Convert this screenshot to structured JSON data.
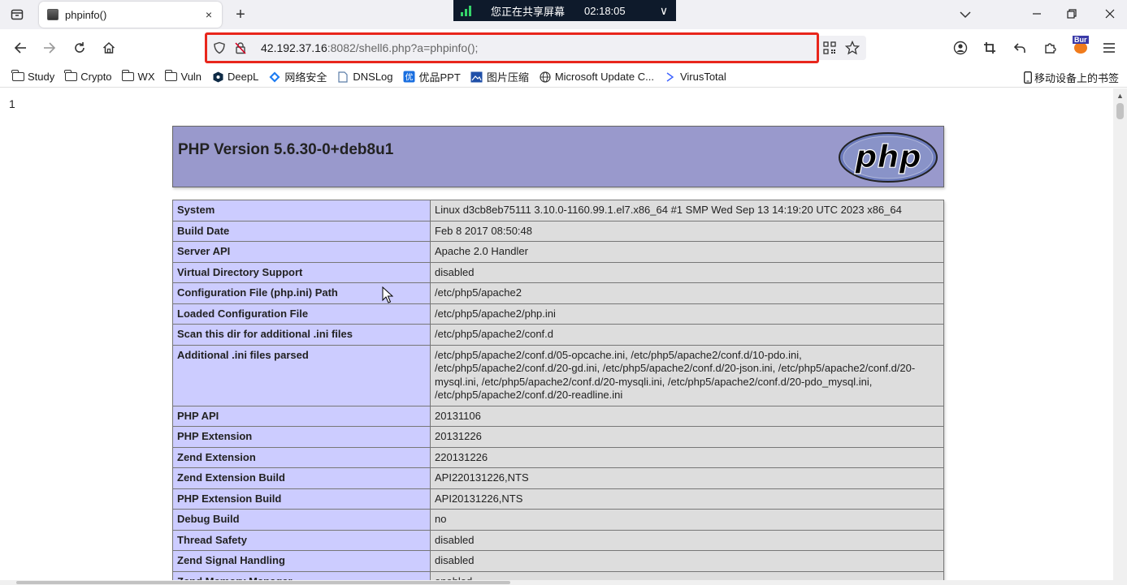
{
  "tab": {
    "title": "phpinfo()",
    "close": "×",
    "new_tab": "+"
  },
  "share_banner": {
    "text": "您正在共享屏幕",
    "time": "02:18:05",
    "chevron": "∨"
  },
  "url": {
    "host": "42.192.37.16",
    "rest": ":8082/shell6.php?a=phpinfo();"
  },
  "burp_label": "Bur",
  "bookmarks": [
    {
      "label": "Study",
      "icon": "folder-icon"
    },
    {
      "label": "Crypto",
      "icon": "folder-icon"
    },
    {
      "label": "WX",
      "icon": "folder-icon"
    },
    {
      "label": "Vuln",
      "icon": "folder-icon"
    },
    {
      "label": "DeepL",
      "icon": "deepl-icon"
    },
    {
      "label": "网络安全",
      "icon": "network-security-icon"
    },
    {
      "label": "DNSLog",
      "icon": "page-icon"
    },
    {
      "label": "优品PPT",
      "icon": "ppt-icon"
    },
    {
      "label": "图片压缩",
      "icon": "image-compress-icon"
    },
    {
      "label": "Microsoft Update C...",
      "icon": "globe-icon"
    },
    {
      "label": "VirusTotal",
      "icon": "virustotal-icon"
    }
  ],
  "mobile_bookmarks": "移动设备上的书签",
  "page": {
    "stray_output": "1",
    "php_version": "PHP Version 5.6.30-0+deb8u1",
    "php_logo_text": "php",
    "rows": [
      {
        "label": "System",
        "value": "Linux d3cb8eb75111 3.10.0-1160.99.1.el7.x86_64 #1 SMP Wed Sep 13 14:19:20 UTC 2023 x86_64"
      },
      {
        "label": "Build Date",
        "value": "Feb 8 2017 08:50:48"
      },
      {
        "label": "Server API",
        "value": "Apache 2.0 Handler"
      },
      {
        "label": "Virtual Directory Support",
        "value": "disabled"
      },
      {
        "label": "Configuration File (php.ini) Path",
        "value": "/etc/php5/apache2"
      },
      {
        "label": "Loaded Configuration File",
        "value": "/etc/php5/apache2/php.ini"
      },
      {
        "label": "Scan this dir for additional .ini files",
        "value": "/etc/php5/apache2/conf.d"
      },
      {
        "label": "Additional .ini files parsed",
        "value": "/etc/php5/apache2/conf.d/05-opcache.ini, /etc/php5/apache2/conf.d/10-pdo.ini, /etc/php5/apache2/conf.d/20-gd.ini, /etc/php5/apache2/conf.d/20-json.ini, /etc/php5/apache2/conf.d/20-mysql.ini, /etc/php5/apache2/conf.d/20-mysqli.ini, /etc/php5/apache2/conf.d/20-pdo_mysql.ini, /etc/php5/apache2/conf.d/20-readline.ini"
      },
      {
        "label": "PHP API",
        "value": "20131106"
      },
      {
        "label": "PHP Extension",
        "value": "20131226"
      },
      {
        "label": "Zend Extension",
        "value": "220131226"
      },
      {
        "label": "Zend Extension Build",
        "value": "API220131226,NTS"
      },
      {
        "label": "PHP Extension Build",
        "value": "API20131226,NTS"
      },
      {
        "label": "Debug Build",
        "value": "no"
      },
      {
        "label": "Thread Safety",
        "value": "disabled"
      },
      {
        "label": "Zend Signal Handling",
        "value": "disabled"
      },
      {
        "label": "Zend Memory Manager",
        "value": "enabled"
      }
    ]
  }
}
